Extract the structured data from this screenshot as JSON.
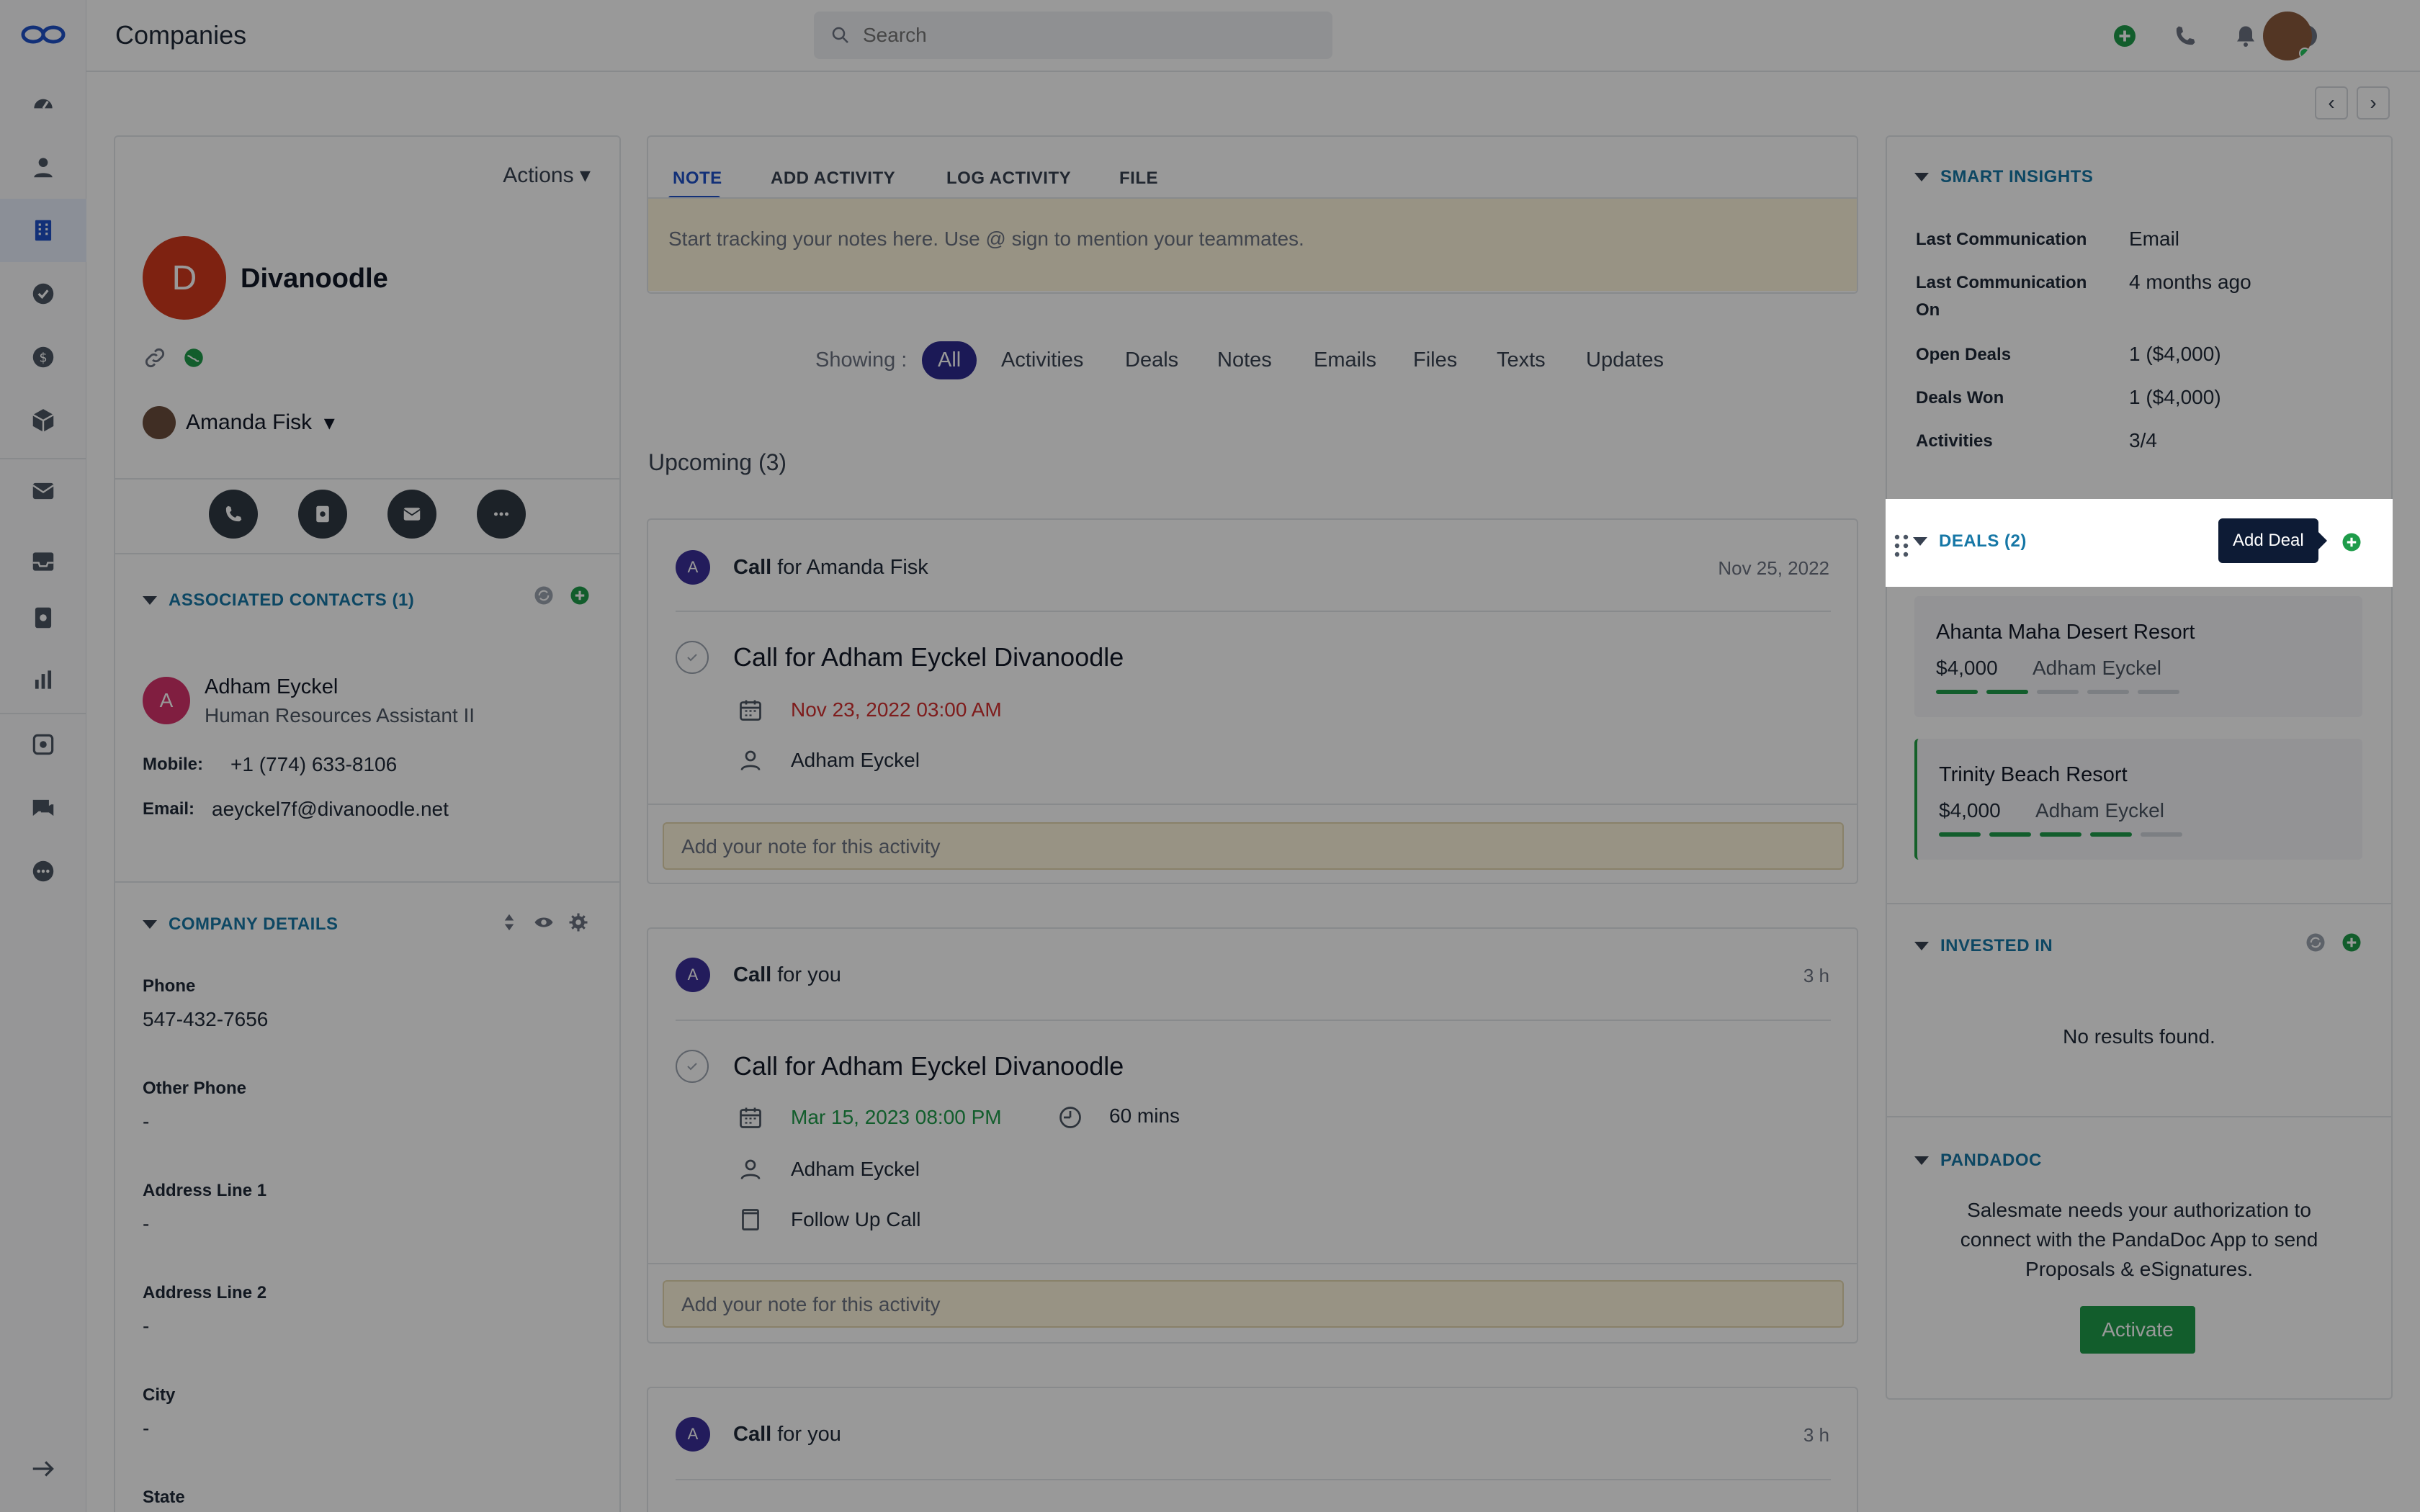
{
  "app": {
    "page_title": "Companies"
  },
  "header": {
    "search_placeholder": "Search"
  },
  "company": {
    "avatar_letter": "D",
    "name": "Divanoodle",
    "actions_label": "Actions",
    "owner": "Amanda Fisk"
  },
  "associated_contacts": {
    "title": "ASSOCIATED CONTACTS (1)",
    "contact": {
      "avatar_letter": "A",
      "name": "Adham Eyckel",
      "title": "Human Resources Assistant II",
      "mobile_label": "Mobile:",
      "mobile": "+1 (774) 633-8106",
      "email_label": "Email:",
      "email": "aeyckel7f@divanoodle.net"
    }
  },
  "company_details": {
    "title": "COMPANY DETAILS",
    "fields": [
      {
        "label": "Phone",
        "value": "547-432-7656"
      },
      {
        "label": "Other Phone",
        "value": "-"
      },
      {
        "label": "Address Line 1",
        "value": "-"
      },
      {
        "label": "Address Line 2",
        "value": "-"
      },
      {
        "label": "City",
        "value": "-"
      },
      {
        "label": "State",
        "value": ""
      }
    ]
  },
  "composer": {
    "tabs": [
      "NOTE",
      "ADD ACTIVITY",
      "LOG ACTIVITY",
      "FILE"
    ],
    "placeholder": "Start tracking your notes here. Use @ sign to mention your teammates."
  },
  "timeline_filter": {
    "label": "Showing :",
    "options": [
      "All",
      "Activities",
      "Deals",
      "Notes",
      "Emails",
      "Files",
      "Texts",
      "Updates"
    ]
  },
  "upcoming": {
    "title": "Upcoming (3)",
    "items": [
      {
        "avatar": "A",
        "type": "Call",
        "for_text": "for Amanda Fisk",
        "when": "Nov 25, 2022",
        "title": "Call for Adham Eyckel Divanoodle",
        "date": "Nov 23, 2022 03:00 AM",
        "contact": "Adham Eyckel",
        "note_placeholder": "Add your note for this activity"
      },
      {
        "avatar": "A",
        "type": "Call",
        "for_text": "for you",
        "when": "3 h",
        "title": "Call for Adham Eyckel Divanoodle",
        "date": "Mar 15, 2023 08:00 PM",
        "duration": "60 mins",
        "contact": "Adham Eyckel",
        "followup": "Follow Up Call",
        "note_placeholder": "Add your note for this activity"
      },
      {
        "avatar": "A",
        "type": "Call",
        "for_text": "for you",
        "when": "3 h"
      }
    ]
  },
  "smart_insights": {
    "title": "SMART INSIGHTS",
    "rows": [
      {
        "label": "Last Communication",
        "value": "Email"
      },
      {
        "label": "Last Communication On",
        "value": "4 months ago"
      },
      {
        "label": "Open Deals",
        "value": "1 ($4,000)"
      },
      {
        "label": "Deals Won",
        "value": "1 ($4,000)"
      },
      {
        "label": "Activities",
        "value": "3/4"
      }
    ]
  },
  "deals": {
    "title": "DEALS (2)",
    "tooltip": "Add Deal",
    "items": [
      {
        "name": "Ahanta Maha Desert Resort",
        "amount": "$4,000",
        "owner": "Adham Eyckel",
        "stages_done": 2,
        "stages_total": 5
      },
      {
        "name": "Trinity Beach Resort",
        "amount": "$4,000",
        "owner": "Adham Eyckel",
        "stages_done": 4,
        "stages_total": 5
      }
    ]
  },
  "invested_in": {
    "title": "INVESTED IN",
    "empty": "No results found."
  },
  "pandadoc": {
    "title": "PANDADOC",
    "message": "Salesmate needs your authorization to connect with the PandaDoc App to send Proposals & eSignatures.",
    "button": "Activate"
  },
  "colors": {
    "accent": "#1e50c8",
    "success": "#1e9c4a",
    "danger": "#d32f2f",
    "teal": "#1677a6",
    "overlay": "rgba(0,0,0,0.40)"
  }
}
